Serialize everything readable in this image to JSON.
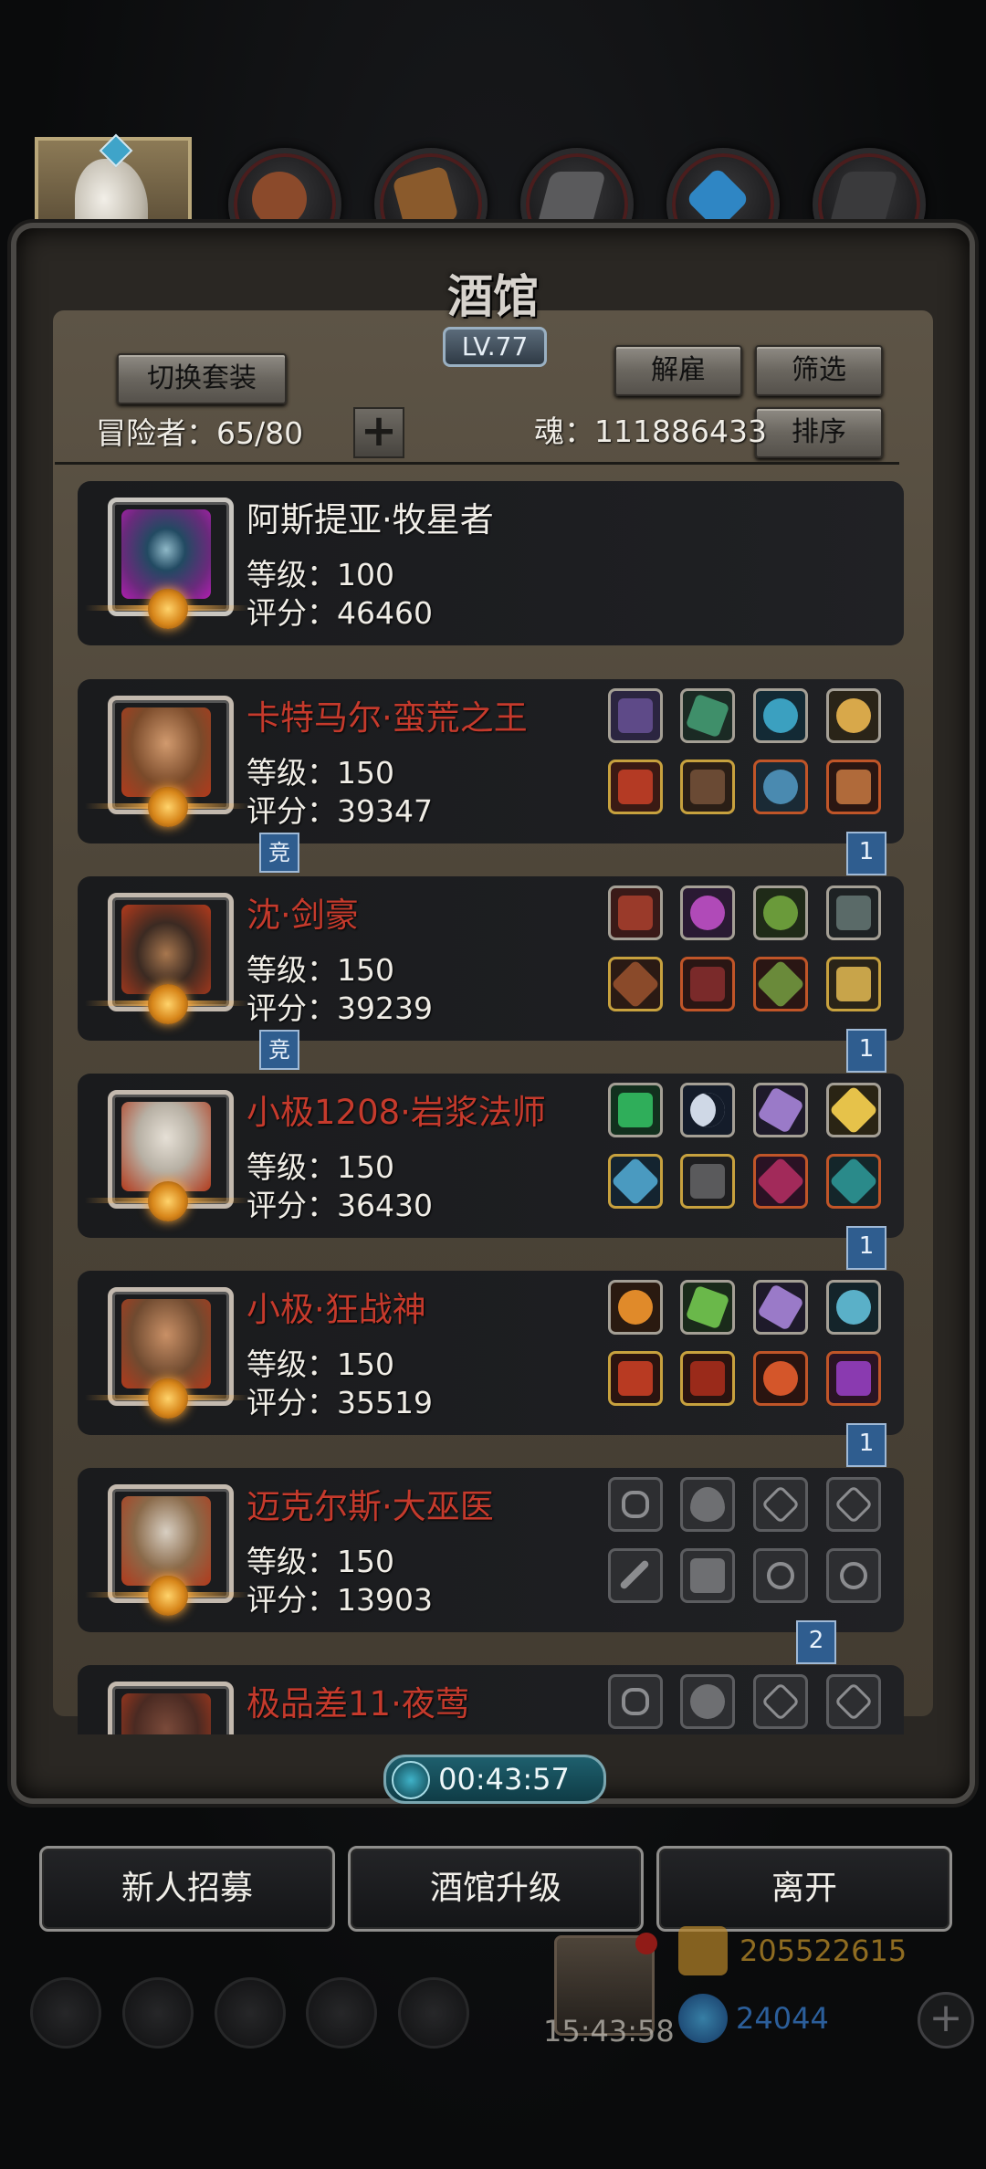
{
  "header": {
    "title": "酒馆",
    "level": "LV.77",
    "switch_outfit_label": "切换套装",
    "dismiss_label": "解雇",
    "filter_label": "筛选",
    "sort_label": "排序",
    "adventurers_label": "冒险者：65/80",
    "soul_label": "魂：111886433",
    "add_symbol": "+"
  },
  "tabs": [
    {
      "icon": "horse-icon"
    },
    {
      "icon": "leather-armor-icon",
      "color": "#8b4a2b"
    },
    {
      "icon": "wood-plank-icon",
      "color": "#8a5a2c"
    },
    {
      "icon": "iron-ingot-icon",
      "color": "#5a5a5c"
    },
    {
      "icon": "blue-crystal-icon",
      "color": "#2f86c4"
    },
    {
      "icon": "dark-ingot-icon",
      "color": "#3a3a3c"
    }
  ],
  "heroes": [
    {
      "name": "阿斯提亚·牧星者",
      "level": "等级：100",
      "score": "评分：46460",
      "name_color": "white",
      "portrait_color": "#6a2a7c"
    },
    {
      "name": "卡特马尔·蛮荒之王",
      "level": "等级：150",
      "score": "评分：39347",
      "name_color": "red",
      "portrait_color": "#7a4a2a",
      "tag": "竞",
      "rank": "1"
    },
    {
      "name": "沈·剑豪",
      "level": "等级：150",
      "score": "评分：39239",
      "name_color": "red",
      "portrait_color": "#3b2a22",
      "tag": "竞",
      "rank": "1"
    },
    {
      "name": "小极1208·岩浆法师",
      "level": "等级：150",
      "score": "评分：36430",
      "name_color": "red",
      "portrait_color": "#b7b0a4",
      "rank": "1"
    },
    {
      "name": "小极·狂战神",
      "level": "等级：150",
      "score": "评分：35519",
      "name_color": "red",
      "portrait_color": "#6f4a30",
      "rank": "1"
    },
    {
      "name": "迈克尔斯·大巫医",
      "level": "等级：150",
      "score": "评分：13903",
      "name_color": "red",
      "portrait_color": "#8a6a4a",
      "rank": "2"
    },
    {
      "name": "极品差11·夜莺",
      "name_color": "red",
      "portrait_color": "#4a2a22"
    }
  ],
  "timer": "00:43:57",
  "actions": {
    "recruit_label": "新人招募",
    "upgrade_label": "酒馆升级",
    "leave_label": "离开"
  },
  "footer": {
    "clock": "15:43:58",
    "gold": "205522615",
    "gems": "24044",
    "add_symbol": "+"
  }
}
